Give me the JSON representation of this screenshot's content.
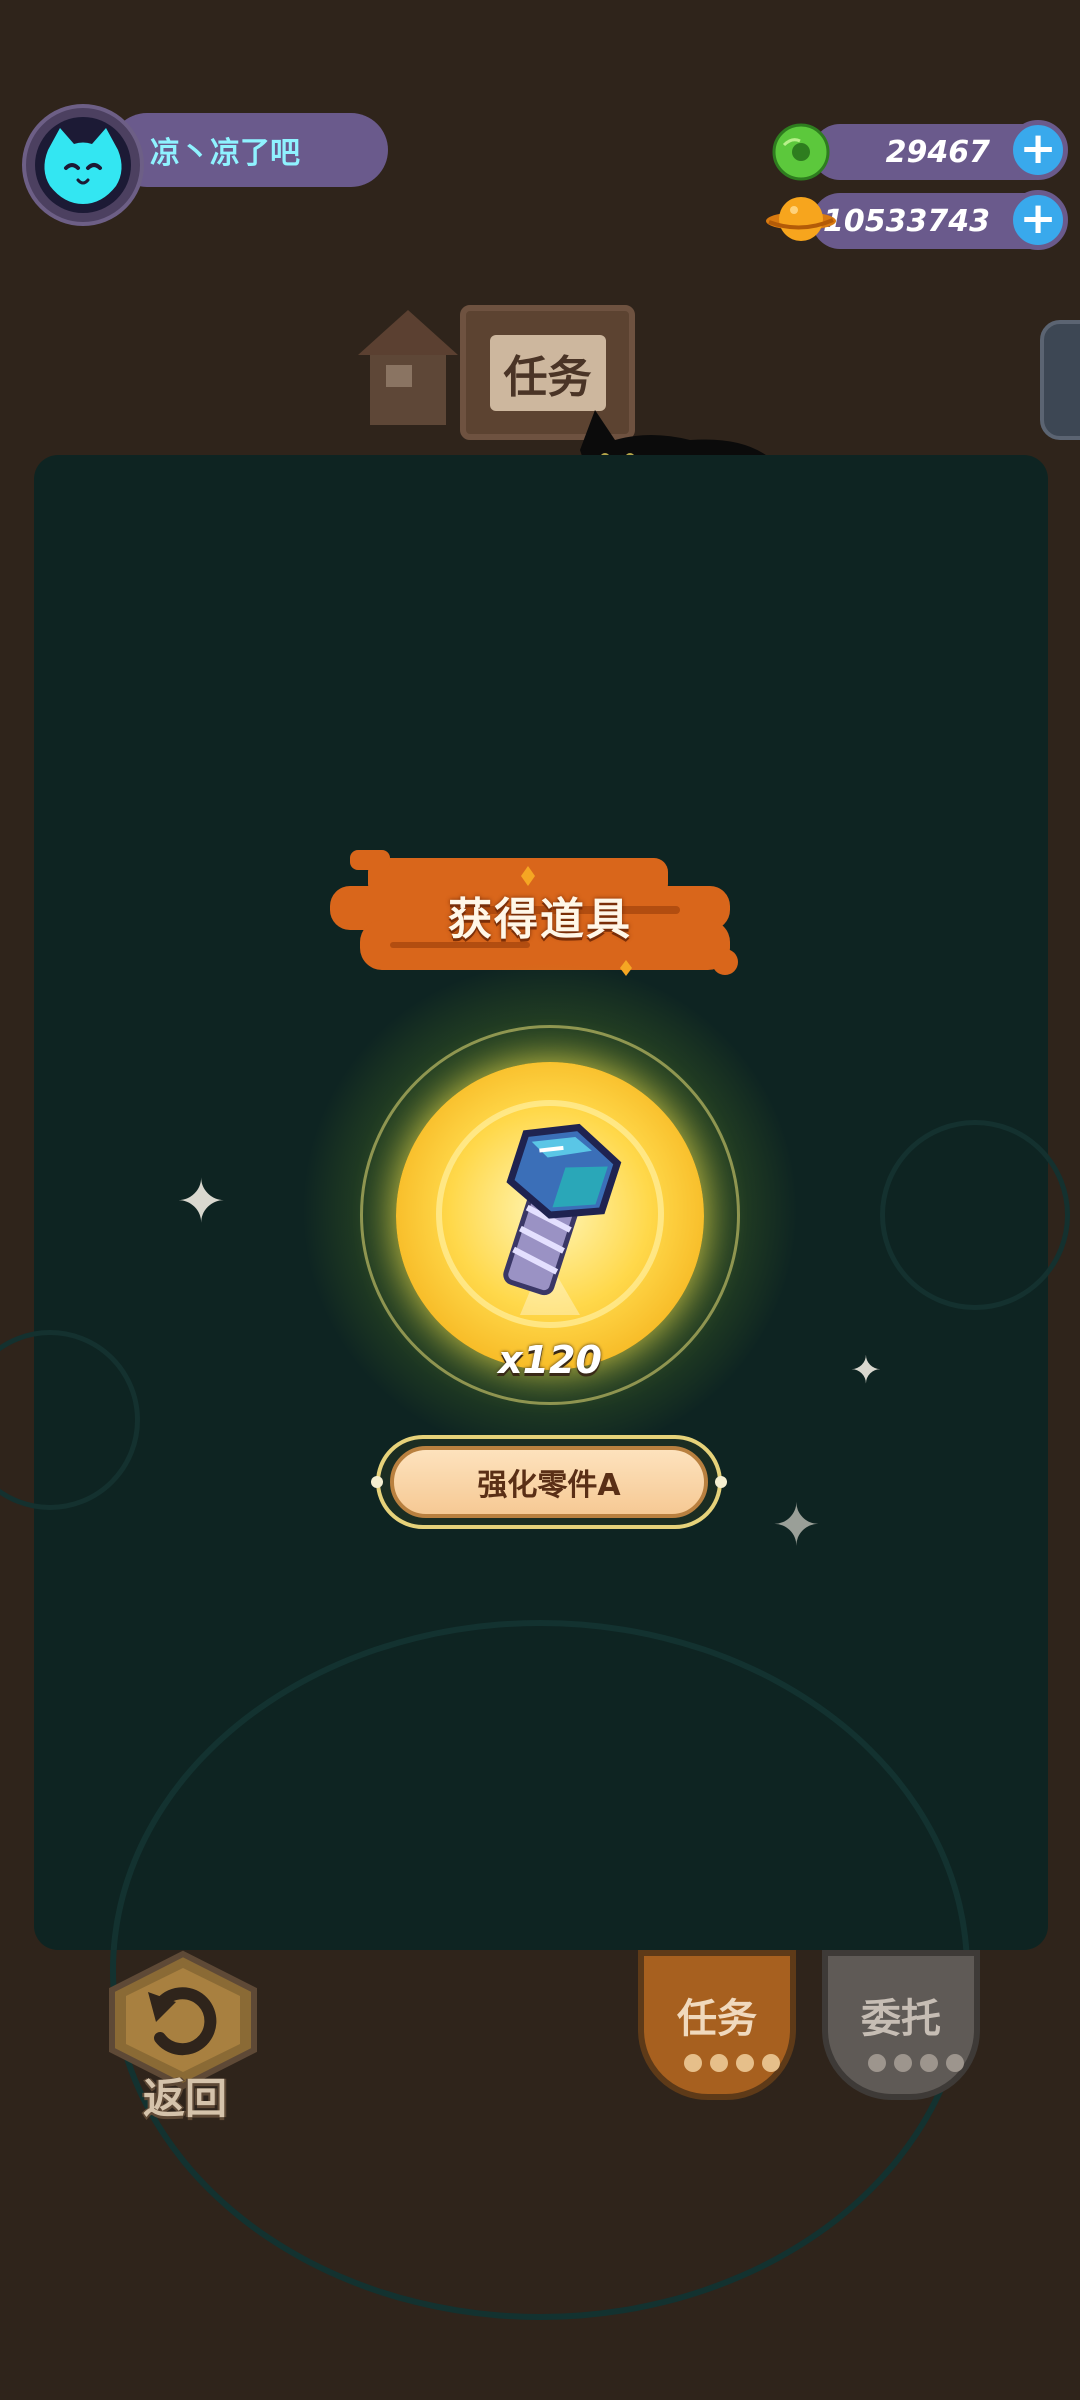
{
  "player": {
    "name": "凉丶凉了吧",
    "avatar_icon": "cat-face-icon"
  },
  "currencies": [
    {
      "icon": "green-donut-icon",
      "value": "29467",
      "color": "#5cc83c"
    },
    {
      "icon": "orange-planet-icon",
      "value": "10533743",
      "color": "#f7a51d"
    }
  ],
  "background": {
    "task_sign_label": "任务"
  },
  "reward_popup": {
    "title": "获得道具",
    "item_icon": "bolt-icon",
    "quantity": "x120",
    "item_name": "强化零件A"
  },
  "bottom": {
    "back_label": "返回",
    "task_label": "任务",
    "commission_label": "委托"
  },
  "colors": {
    "modal_bg": "#0e2422",
    "banner": "#d9661b",
    "accent_blue": "#39a9ec",
    "pill": "#6a5a8c"
  }
}
